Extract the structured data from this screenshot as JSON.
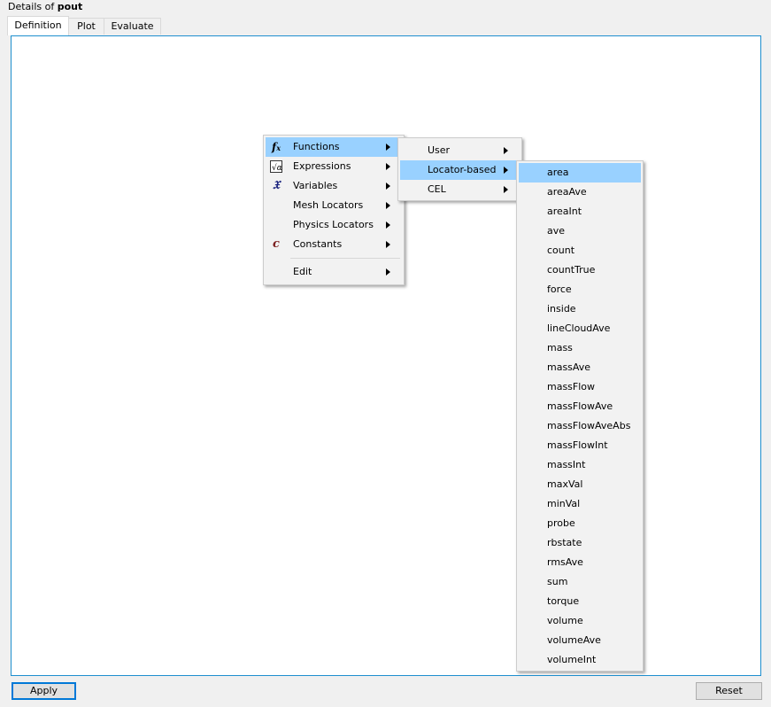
{
  "header": {
    "prefix": "Details of ",
    "object_name": "pout"
  },
  "tabs": [
    {
      "label": "Definition",
      "active": true
    },
    {
      "label": "Plot",
      "active": false
    },
    {
      "label": "Evaluate",
      "active": false
    }
  ],
  "context_menu": {
    "items": [
      {
        "label": "Functions",
        "icon": "fx-icon",
        "submenu": true,
        "highlighted": true
      },
      {
        "label": "Expressions",
        "icon": "expression-icon",
        "submenu": true
      },
      {
        "label": "Variables",
        "icon": "variable-icon",
        "submenu": true
      },
      {
        "label": "Mesh Locators",
        "icon": "",
        "submenu": true
      },
      {
        "label": "Physics Locators",
        "icon": "",
        "submenu": true
      },
      {
        "label": "Constants",
        "icon": "constant-icon",
        "submenu": true
      },
      {
        "label": "Edit",
        "icon": "",
        "submenu": true
      }
    ]
  },
  "functions_submenu": {
    "items": [
      {
        "label": "User",
        "submenu": true
      },
      {
        "label": "Locator-based",
        "submenu": true,
        "highlighted": true
      },
      {
        "label": "CEL",
        "submenu": true
      }
    ]
  },
  "locator_submenu": {
    "items": [
      "area",
      "areaAve",
      "areaInt",
      "ave",
      "count",
      "countTrue",
      "force",
      "inside",
      "lineCloudAve",
      "mass",
      "massAve",
      "massFlow",
      "massFlowAve",
      "massFlowAveAbs",
      "massFlowInt",
      "massInt",
      "maxVal",
      "minVal",
      "probe",
      "rbstate",
      "rmsAve",
      "sum",
      "torque",
      "volume",
      "volumeAve",
      "volumeInt"
    ],
    "highlighted_index": 0
  },
  "buttons": {
    "apply": "Apply",
    "reset": "Reset"
  },
  "colors": {
    "highlight": "#99d1ff",
    "panel_border": "#1e8fcf",
    "focus_border": "#0078d7"
  }
}
